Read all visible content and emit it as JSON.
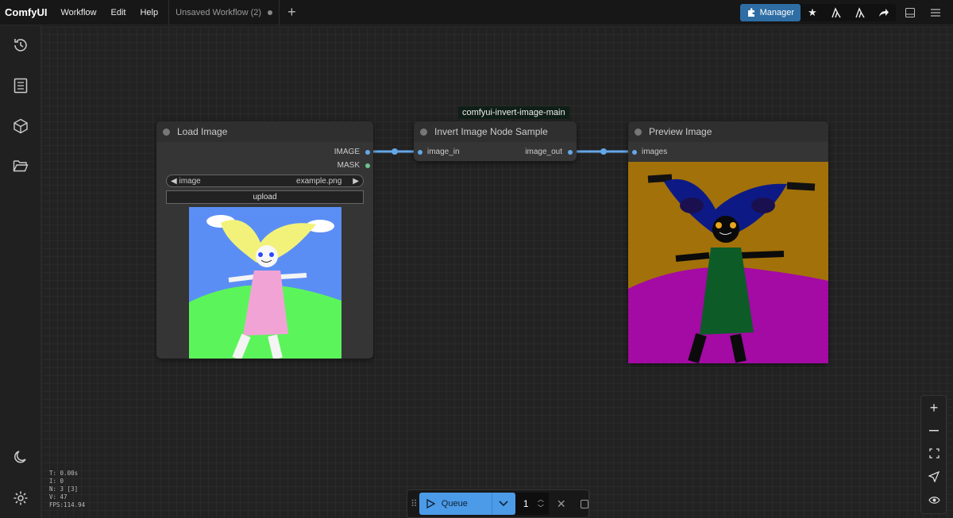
{
  "topbar": {
    "logo": "ComfyUI",
    "menu": [
      "Workflow",
      "Edit",
      "Help"
    ],
    "tab_title": "Unsaved Workflow (2)",
    "manager_label": "Manager"
  },
  "group": {
    "title": "comfyui-invert-image-main"
  },
  "nodes": {
    "load_image": {
      "title": "Load Image",
      "outputs": [
        "IMAGE",
        "MASK"
      ],
      "image_widget_label": "image",
      "image_widget_value": "example.png",
      "upload_label": "upload"
    },
    "invert": {
      "title": "Invert Image Node Sample",
      "input": "image_in",
      "output": "image_out"
    },
    "preview": {
      "title": "Preview Image",
      "input": "images"
    }
  },
  "stats": {
    "t": "T: 0.00s",
    "i": "I: 0",
    "n": "N: 3 [3]",
    "v": "V: 47",
    "fps": "FPS:114.94"
  },
  "queue": {
    "label": "Queue",
    "count": "1"
  },
  "colors": {
    "accent": "#4c9be8",
    "manager": "#2e6ea4",
    "link": "#64a7e8"
  }
}
